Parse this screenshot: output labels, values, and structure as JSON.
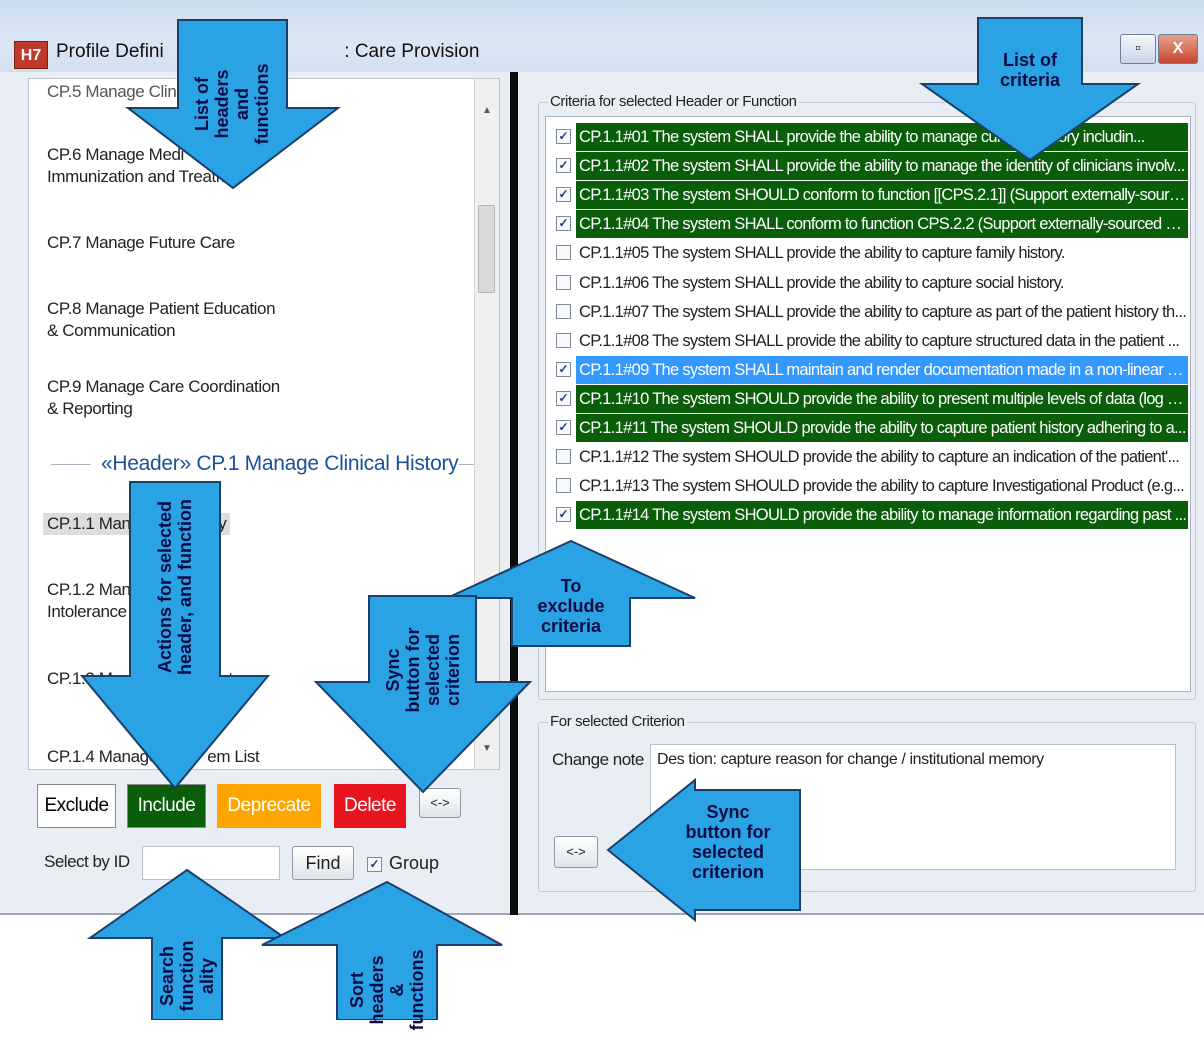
{
  "window": {
    "title": "Profile Defini",
    "title_tail": ": Care Provision",
    "icon": "hl7-icon",
    "controls": {
      "restore": "▫",
      "close": "X"
    }
  },
  "functions_list": {
    "partial_top": "CP.5 Manage Clinical...",
    "items": [
      {
        "label": "CP.6 Manage Medi\nImmunization and Treatm"
      },
      {
        "label": "CP.7 Manage Future Care"
      },
      {
        "label": "CP.8 Manage Patient Education\n& Communication"
      },
      {
        "label": "CP.9 Manage Care Coordination\n& Reporting"
      }
    ],
    "header_label": "«Header» CP.1 Manage Clinical History",
    "sub_items": [
      {
        "label": "CP.1.1 Mana            story"
      },
      {
        "label": "CP.1.2 Mana\nIntolerance"
      },
      {
        "label": "CP.1.3 Ma                    List"
      },
      {
        "label": "CP.1.4 Manage P        em List"
      }
    ]
  },
  "actions": {
    "exclude": "Exclude",
    "include": "Include",
    "deprecate": "Deprecate",
    "delete": "Delete",
    "sync": "<->",
    "select_by_id_label": "Select by ID",
    "select_by_id_value": "",
    "find": "Find",
    "group_label": "Group",
    "group_checked": "✓"
  },
  "criteria": {
    "group_label": "Criteria for selected Header or Function",
    "rows": [
      {
        "text": "CP.1.1#01 The system SHALL provide the ability to manage curr          ent history includin...",
        "checked": "✓",
        "state": "inc"
      },
      {
        "text": "CP.1.1#02 The system SHALL provide the ability to manage the identity of clinicians involv...",
        "checked": "✓",
        "state": "inc"
      },
      {
        "text": "CP.1.1#03 The system SHOULD conform to function [[CPS.2.1]] (Support externally-sourc...",
        "checked": "✓",
        "state": "inc"
      },
      {
        "text": "CP.1.1#04 The system SHALL conform to function CPS.2.2 (Support externally-sourced Cli...",
        "checked": "✓",
        "state": "inc"
      },
      {
        "text": "CP.1.1#05 The system SHALL provide the ability to capture family history.",
        "checked": "",
        "state": "plain"
      },
      {
        "text": "CP.1.1#06 The system SHALL provide the ability to capture social history.",
        "checked": "",
        "state": "plain"
      },
      {
        "text": "CP.1.1#07 The system SHALL provide the ability to capture as part of the patient history th...",
        "checked": "",
        "state": "plain"
      },
      {
        "text": "CP.1.1#08 The system SHALL provide the ability to capture structured data in the patient ...",
        "checked": "",
        "state": "plain"
      },
      {
        "text": "CP.1.1#09 The system SHALL maintain and render documentation made in a non-linear as...",
        "checked": "✓",
        "state": "hl"
      },
      {
        "text": "CP.1.1#10 The system SHOULD provide the ability to present multiple levels of data (log vi...",
        "checked": "✓",
        "state": "inc"
      },
      {
        "text": "CP.1.1#11 The system SHOULD provide the ability to capture patient history adhering to a...",
        "checked": "✓",
        "state": "inc"
      },
      {
        "text": "CP.1.1#12 The system SHOULD provide the ability to capture an indication of the patient'...",
        "checked": "",
        "state": "plain"
      },
      {
        "text": "CP.1.1#13 The system SHOULD provide the ability to capture Investigational Product (e.g...",
        "checked": "",
        "state": "plain"
      },
      {
        "text": "CP.1.1#14 The system SHOULD provide the ability to manage information regarding past ...",
        "checked": "✓",
        "state": "inc"
      }
    ]
  },
  "selected_criterion": {
    "group_label": "For selected Criterion",
    "change_note_label": "Change note",
    "change_note_value": "Des        tion: capture reason for change / institutional memory",
    "sync": "<->"
  },
  "annotations": {
    "list_headers": "List of\nheaders\nand\nfunctions",
    "list_criteria": "List of\ncriteria",
    "actions": "Actions for selected\nheader, and function",
    "to_exclude": "To\nexclude\ncriteria",
    "sync_left": "Sync\nbutton for\nselected\ncriterion",
    "sync_right": "Sync\nbutton for\nselected\ncriterion",
    "search": "Search\nfunction\nality",
    "sort": "Sort\nheaders\n&\nfunctions"
  },
  "colors": {
    "include_bg": "#0a5e0a",
    "deprecate_bg": "#ffa500",
    "delete_bg": "#e8141f",
    "highlight_row": "#3399ff",
    "arrow_fill": "#29a3e3",
    "header_text": "#1d4f9a"
  }
}
